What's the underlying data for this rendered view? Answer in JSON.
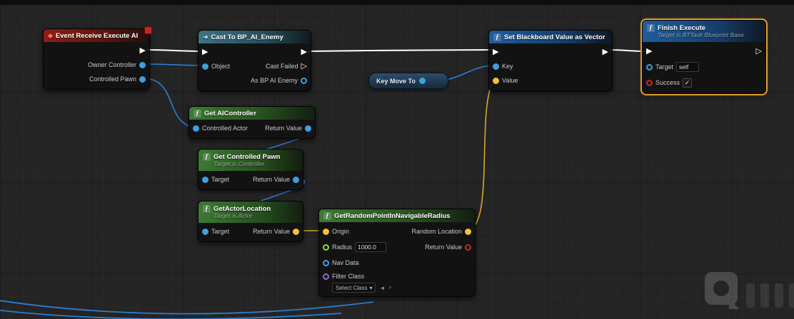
{
  "editor": {
    "app": "Unreal Engine Blueprint Graph"
  },
  "colors": {
    "pin_object_blue": "#3f9fe0",
    "pin_vector_yellow": "#f2c134",
    "pin_float_green": "#8ddc3f",
    "pin_bool_red": "#c9281e",
    "pin_class_purple": "#9268cf",
    "pin_exec_white": "#ffffff",
    "wire_blue": "#2a7fd4",
    "wire_yellow": "#d9a72e",
    "header_event_red": "#8e1e12",
    "header_function_green": "#3c7a33",
    "header_blackboard_blue": "#1f5d9d",
    "header_cast_teal": "#3c7486",
    "selection_orange": "#e09b2d"
  },
  "icons": {
    "exec_filled": "▶",
    "exec_hollow": "▷",
    "event": "◆",
    "fn": "ƒ",
    "cast": "➜",
    "dropdown_caret": "▾",
    "check": "✓",
    "pick_arrow": "◄",
    "search": "⌕"
  },
  "nodes": {
    "event_receive_execute_ai": {
      "title": "Event Receive Execute AI",
      "pins": {
        "owner_controller": "Owner Controller",
        "controlled_pawn": "Controlled Pawn"
      }
    },
    "cast_to_bp_ai_enemy": {
      "title": "Cast To BP_AI_Enemy",
      "pins": {
        "object": "Object",
        "cast_failed": "Cast Failed",
        "as_bp_ai_enemy": "As BP AI Enemy"
      }
    },
    "set_blackboard_value_as_vector": {
      "title": "Set Blackboard Value as Vector",
      "pins": {
        "key": "Key",
        "value": "Value"
      }
    },
    "finish_execute": {
      "title": "Finish Execute",
      "subtitle": "Target is BTTask Blueprint Base",
      "pins": {
        "target": "Target",
        "success": "Success"
      },
      "target_value": "self",
      "success_checked": true
    },
    "key_move_to": {
      "title": "Key Move To"
    },
    "get_aicontroller": {
      "title": "Get AIController",
      "pins": {
        "controlled_actor": "Controlled Actor",
        "return_value": "Return Value"
      }
    },
    "get_controlled_pawn": {
      "title": "Get Controlled Pawn",
      "subtitle": "Target is Controller",
      "pins": {
        "target": "Target",
        "return_value": "Return Value"
      }
    },
    "get_actor_location": {
      "title": "GetActorLocation",
      "subtitle": "Target is Actor",
      "pins": {
        "target": "Target",
        "return_value": "Return Value"
      }
    },
    "get_random_point_in_navigable_radius": {
      "title": "GetRandomPointInNavigableRadius",
      "pins": {
        "origin": "Origin",
        "radius": "Radius",
        "nav_data": "Nav Data",
        "filter_class": "Filter Class",
        "random_location": "Random Location",
        "return_value": "Return Value"
      },
      "radius_value": "1000.0",
      "filter_class_value": "Select Class"
    }
  }
}
